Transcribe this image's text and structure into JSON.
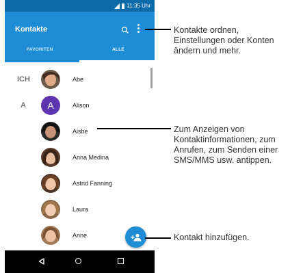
{
  "status_bar": {
    "time": "11:35 Uhr"
  },
  "app_bar": {
    "title": "Kontakte",
    "tabs": [
      {
        "label": "FAVORITEN",
        "selected": false
      },
      {
        "label": "ALLE",
        "selected": true
      }
    ]
  },
  "contacts": {
    "sections": [
      {
        "letter": "ICH"
      },
      {
        "letter": "A"
      }
    ],
    "items": [
      {
        "name": "Abe",
        "avatar": "photo"
      },
      {
        "name": "Alison",
        "avatar": "letter",
        "initial": "A"
      },
      {
        "name": "Aishe",
        "avatar": "photo"
      },
      {
        "name": "Anna Medina",
        "avatar": "photo"
      },
      {
        "name": "Astrid Fanning",
        "avatar": "photo"
      },
      {
        "name": "Laura",
        "avatar": "photo"
      },
      {
        "name": "Anne",
        "avatar": "photo"
      }
    ]
  },
  "callouts": [
    {
      "lines": [
        "Kontakte ordnen,",
        "Einstellungen oder Konten",
        "ändern und mehr."
      ]
    },
    {
      "lines": [
        "Zum Anzeigen von",
        "Kontaktinformationen, zum",
        "Anrufen, zum Senden einer",
        "SMS/MMS usw. antippen."
      ]
    },
    {
      "lines": [
        "Kontakt hinzufügen."
      ]
    }
  ],
  "colors": {
    "status_bar": "#0d6aa8",
    "app_bar": "#1e8dd6",
    "letter_avatar": "#5e35b1",
    "fab": "#1e8dd6"
  },
  "icons": [
    "search-icon",
    "overflow-menu-icon",
    "add-contact-icon",
    "back-icon",
    "home-icon",
    "recent-apps-icon"
  ]
}
